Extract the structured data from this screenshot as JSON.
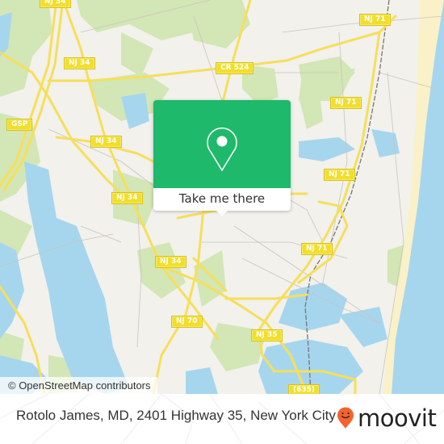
{
  "map": {
    "road_labels": [
      {
        "id": "nj34-top",
        "text": "NJ 34"
      },
      {
        "id": "nj34-a",
        "text": "NJ 34"
      },
      {
        "id": "gsp",
        "text": "GSP"
      },
      {
        "id": "nj34-b",
        "text": "NJ 34"
      },
      {
        "id": "nj34-c",
        "text": "NJ 34"
      },
      {
        "id": "nj34-d",
        "text": "NJ 34"
      },
      {
        "id": "cr524",
        "text": "CR 524"
      },
      {
        "id": "nj71-a",
        "text": "NJ 71"
      },
      {
        "id": "nj71-b",
        "text": "NJ 71"
      },
      {
        "id": "nj71-c",
        "text": "NJ 71"
      },
      {
        "id": "nj71-d",
        "text": "NJ 71"
      },
      {
        "id": "nj70",
        "text": "NJ 70"
      },
      {
        "id": "nj35",
        "text": "NJ 35"
      },
      {
        "id": "cr635",
        "text": "(635)"
      }
    ],
    "attribution": "© OpenStreetMap contributors",
    "colors": {
      "land": "#f2f1ec",
      "park": "#d3e6b5",
      "water": "#a6d6ee",
      "road": "#f6df5a",
      "beach": "#faf1c8"
    }
  },
  "popup": {
    "icon": "map-pin-icon",
    "button_label": "Take me there",
    "accent": "#1eb96a"
  },
  "footer": {
    "place_text": "Rotolo James, MD, 2401 Highway 35, New York City",
    "brand_name": "moovit",
    "brand_icon": "moovit-pin-icon",
    "brand_color": "#f26430"
  }
}
